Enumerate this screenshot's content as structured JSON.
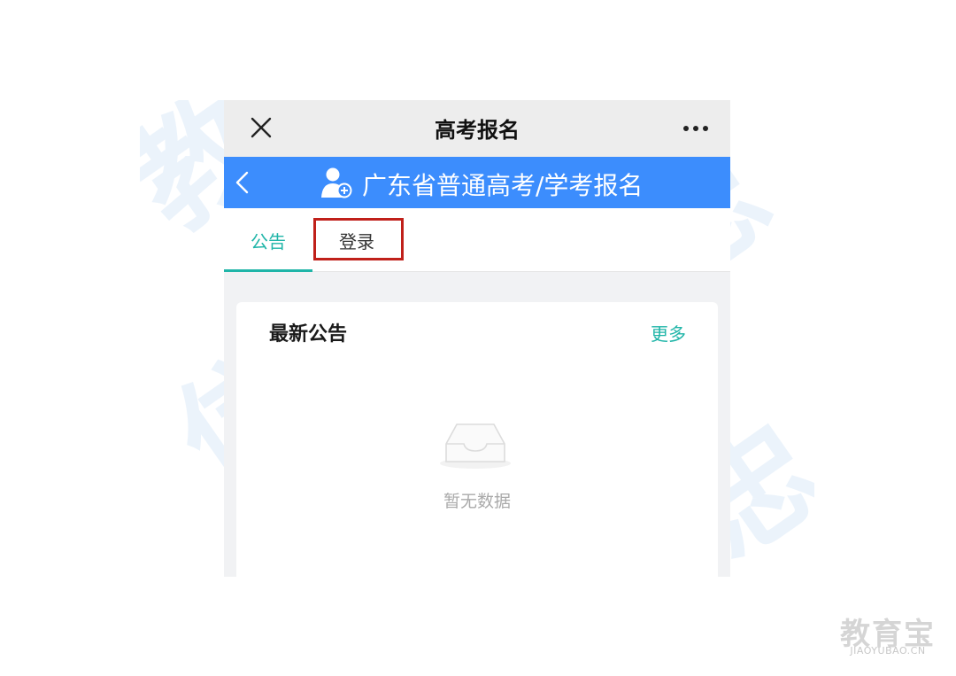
{
  "wechat_bar": {
    "title": "高考报名",
    "close_icon": "close-icon",
    "more_icon": "more-icon"
  },
  "app_bar": {
    "title": "广东省普通高考/学考报名",
    "back_icon": "back-icon",
    "user_icon": "user-add-icon",
    "color": "#3c8dfd"
  },
  "tabs": [
    {
      "label": "公告",
      "active": true
    },
    {
      "label": "登录",
      "active": false,
      "highlighted": true
    }
  ],
  "notice_card": {
    "title": "最新公告",
    "more_label": "更多",
    "empty_text": "暂无数据",
    "empty_icon": "inbox-icon"
  },
  "watermark": {
    "chars": [
      "教",
      "育",
      "宝",
      "忠",
      "信",
      "教",
      "育",
      "忠"
    ]
  },
  "brand": {
    "name": "教育宝",
    "url": "JIAOYUBAO.CN"
  },
  "colors": {
    "accent": "#1fb5a8",
    "highlight_border": "#c0201a"
  }
}
